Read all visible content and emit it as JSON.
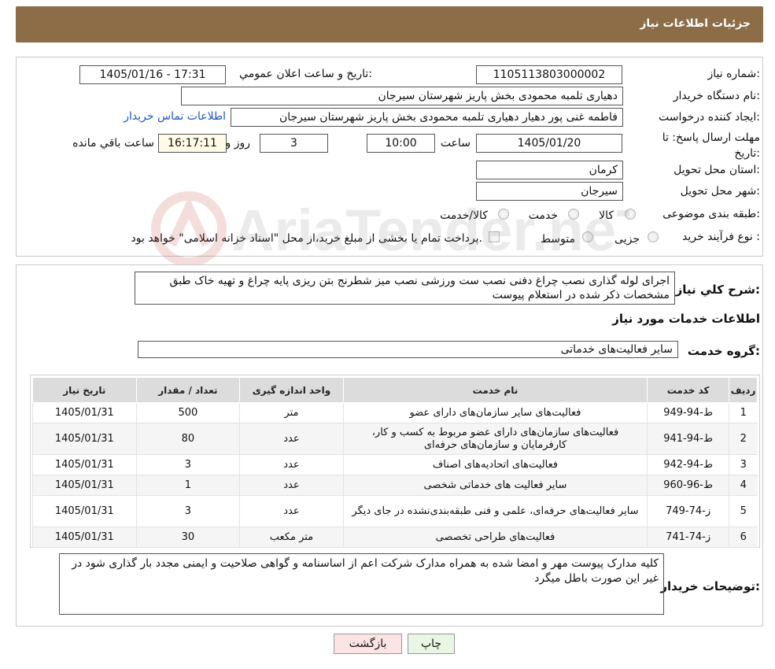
{
  "title": "جزئیات اطلاعات نیاز",
  "fields": {
    "need_number_label": "شماره نیاز:",
    "need_number": "1105113803000002",
    "announce_label": "تاریخ و ساعت اعلان عمومي:",
    "announce_value": "1405/01/16 - 17:31",
    "buyer_org_label": "نام دستگاه خريدار:",
    "buyer_org": "دهیاری تلمبه محمودی بخش پاریز شهرستان سیرجان",
    "creator_label": "ايجاد کننده درخواست:",
    "creator": "فاطمه غنی پور دهیار دهیاری تلمبه محمودی بخش پاریز شهرستان سیرجان",
    "contact_link": "اطلاعات تماس خريدار",
    "deadline_label": "مهلت ارسال پاسخ: تا تاريخ:",
    "deadline_date": "1405/01/20",
    "time_label": "ساعت",
    "deadline_time": "10:00",
    "days_value": "3",
    "days_label": "روز و",
    "remaining_time": "16:17:11",
    "remaining_label": "ساعت باقي مانده",
    "province_label": "استان محل تحويل:",
    "province": "کرمان",
    "city_label": "شهر محل تحويل:",
    "city": "سیرجان",
    "category_label": "طبقه بندی موضوعی:",
    "category_options": [
      "کالا",
      "خدمت",
      "کالا/خدمت"
    ],
    "process_label": "نوع فرآيند خريد :",
    "process_options": [
      "جزیی",
      "متوسط"
    ],
    "process_note": "پرداخت تمام یا بخشی از مبلغ خرید،از محل \"اسناد خزانه اسلامی\" خواهد بود."
  },
  "description": {
    "label": "شرح کلي نياز:",
    "text": "اجرای لوله گذاری نصب چراغ دفنی نصب ست ورزشی نصب میز شطرنج بتن ریزی پایه چراغ و تهیه خاک طبق مشخصات ذکر شده در استعلام پیوست"
  },
  "services": {
    "heading": "اطلاعات خدمات مورد نیاز",
    "group_label": "گروه خدمت:",
    "group_value": "سایر فعالیت‌های خدماتی",
    "columns": [
      "رديف",
      "کد خدمت",
      "نام خدمت",
      "واحد اندازه گيری",
      "تعداد / مقدار",
      "تاريخ نياز"
    ],
    "rows": [
      {
        "row": "1",
        "code": "ط-94-949",
        "name": "فعالیت‌های سایر سازمان‌های دارای عضو",
        "unit": "متر",
        "qty": "500",
        "date": "1405/01/31"
      },
      {
        "row": "2",
        "code": "ط-94-941",
        "name": "فعالیت‌های سازمان‌های دارای عضو مربوط به کسب و کار، کارفرمایان و سازمان‌های حرفه‌ای",
        "unit": "عدد",
        "qty": "80",
        "date": "1405/01/31"
      },
      {
        "row": "3",
        "code": "ط-94-942",
        "name": "فعالیت‌های اتحادیه‌های اصناف",
        "unit": "عدد",
        "qty": "3",
        "date": "1405/01/31"
      },
      {
        "row": "4",
        "code": "ط-96-960",
        "name": "سایر فعالیت های خدماتی شخصی",
        "unit": "عدد",
        "qty": "1",
        "date": "1405/01/31"
      },
      {
        "row": "5",
        "code": "ز-74-749",
        "name": "سایر فعالیت‌های حرفه‌ای، علمی و فنی طبقه‌بندی‌نشده در جای دیگر",
        "unit": "عدد",
        "qty": "3",
        "date": "1405/01/31"
      },
      {
        "row": "6",
        "code": "ز-74-741",
        "name": "فعالیت‌های طراحی تخصصی",
        "unit": "متر مکعب",
        "qty": "30",
        "date": "1405/01/31"
      }
    ]
  },
  "buyer_notes": {
    "label": "توضيحات خريدار:",
    "text": "کلیه مدارک پیوست مهر و امضا شده به همراه مدارک شرکت اعم از اساسنامه و گواهی صلاحیت و ایمنی مجدد بار گذاری شود در غیر این صورت باطل میگرد"
  },
  "buttons": {
    "print": "چاپ",
    "back": "بازگشت"
  },
  "watermark_text": "AriaTender.neT",
  "colors": {
    "header": "#8c6d47",
    "back_button": "#fde4e4",
    "print_button": "#eaf6e4"
  }
}
